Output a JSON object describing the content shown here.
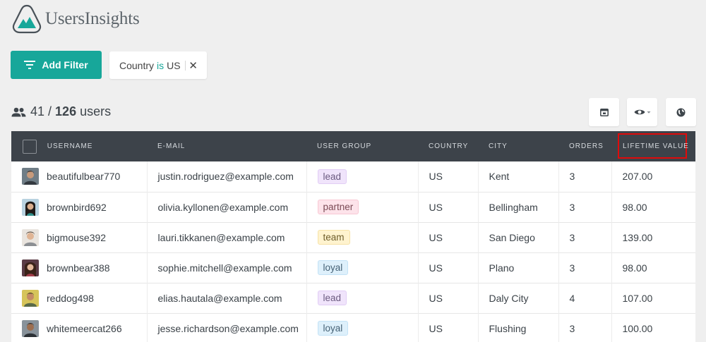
{
  "app": {
    "brand_name": "UsersInsights",
    "accent_color": "#17a79a",
    "header_bg": "#3d434a"
  },
  "toolbar": {
    "add_filter_label": "Add Filter",
    "filter": {
      "field": "Country",
      "operator": "is",
      "value": "US"
    },
    "count": {
      "shown": "41",
      "separator": "/",
      "total": "126",
      "unit": "users"
    },
    "buttons": [
      "columns-icon",
      "visibility-icon",
      "globe-icon"
    ]
  },
  "table": {
    "columns": [
      "USERNAME",
      "E-MAIL",
      "USER GROUP",
      "COUNTRY",
      "CITY",
      "ORDERS",
      "LIFETIME VALUE"
    ],
    "rows": [
      {
        "username": "beautifulbear770",
        "email": "justin.rodriguez@example.com",
        "group": "lead",
        "country": "US",
        "city": "Kent",
        "orders": "3",
        "ltv": "207.00"
      },
      {
        "username": "brownbird692",
        "email": "olivia.kyllonen@example.com",
        "group": "partner",
        "country": "US",
        "city": "Bellingham",
        "orders": "3",
        "ltv": "98.00"
      },
      {
        "username": "bigmouse392",
        "email": "lauri.tikkanen@example.com",
        "group": "team",
        "country": "US",
        "city": "San Diego",
        "orders": "3",
        "ltv": "139.00"
      },
      {
        "username": "brownbear388",
        "email": "sophie.mitchell@example.com",
        "group": "loyal",
        "country": "US",
        "city": "Plano",
        "orders": "3",
        "ltv": "98.00"
      },
      {
        "username": "reddog498",
        "email": "elias.hautala@example.com",
        "group": "lead",
        "country": "US",
        "city": "Daly City",
        "orders": "4",
        "ltv": "107.00"
      },
      {
        "username": "whitemeercat266",
        "email": "jesse.richardson@example.com",
        "group": "loyal",
        "country": "US",
        "city": "Flushing",
        "orders": "3",
        "ltv": "100.00"
      }
    ]
  }
}
